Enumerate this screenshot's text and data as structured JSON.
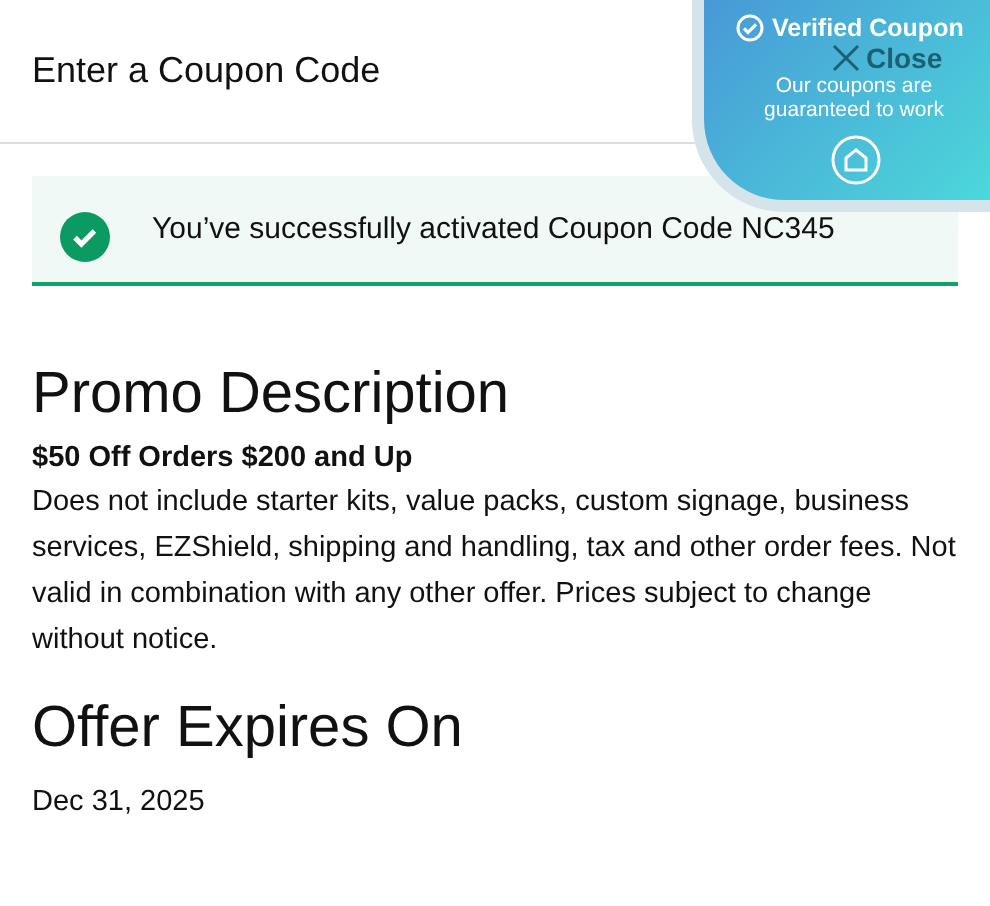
{
  "header": {
    "title": "Enter a Coupon Code",
    "close_label": "Close"
  },
  "badge": {
    "title": "Verified Coupon",
    "subtitle": "Our coupons are guaranteed to work"
  },
  "alert": {
    "message": "You’ve successfully activated Coupon Code NC345"
  },
  "promo": {
    "heading": "Promo Description",
    "offer": "$50 Off Orders $200 and Up",
    "details": "Does not include starter kits, value packs, custom signage, business services, EZShield, shipping and handling, tax and other order fees. Not valid in combination with any other offer. Prices subject to change without notice."
  },
  "expiry": {
    "heading": "Offer Expires On",
    "date": "Dec 31, 2025"
  }
}
